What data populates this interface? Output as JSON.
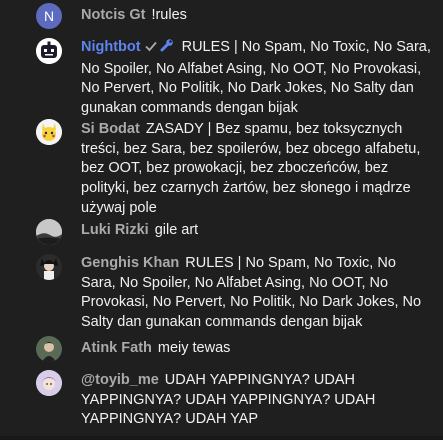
{
  "messages": [
    {
      "author": "Notcis Gt",
      "text": "!rules",
      "avatar_letter": "N"
    },
    {
      "author": "Nightbot",
      "text": "RULES | No Spam, No Toxic, No Sara, No Spoiler, No Alfabet Asing, No OOT, No Provokasi, No Pervert, No Politik, No Dark Jokes, No Salty dan gunakan commands dengan bijak",
      "badges": [
        "check-icon",
        "wrench-icon"
      ]
    },
    {
      "author": "Si Bodat",
      "text": "ZASADY | Bez spamu, bez toksycznych treści, bez Sara, bez spoilerów, bez obcego alfabetu, bez OOT, bez prowokacji, bez zboczeńców, bez polityki, bez czarnych żartów, bez słonego i mądrze używaj pole"
    },
    {
      "author": "Luki Rizki",
      "text": "gile art"
    },
    {
      "author": "Genghis Khan",
      "text": "RULES | No Spam, No Toxic, No Sara, No Spoiler, No Alfabet Asing, No OOT, No Provokasi, No Pervert, No Politik, No Dark Jokes, No Salty dan gunakan commands dengan bijak"
    },
    {
      "author": "Atink Fath",
      "text": "meiy tewas"
    },
    {
      "author": "@toyib_me",
      "text": "UDAH YAPPINGNYA? UDAH YAPPINGNYA? UDAH YAPPINGNYA? UDAH YAPPINGNYA? UDAH YAP"
    }
  ],
  "colors": {
    "background": "#1f1f1f",
    "author": "#aaaaaa",
    "moderator_author": "#5e84f1",
    "text": "#f1f1f1"
  }
}
